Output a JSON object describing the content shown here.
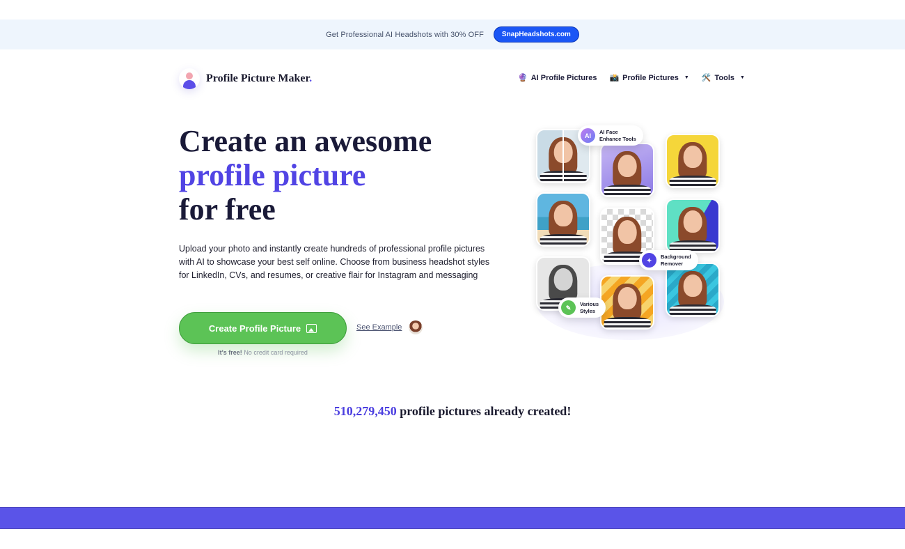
{
  "promo": {
    "text": "Get Professional AI Headshots with 30% OFF",
    "button_label": "SnapHeadshots.com"
  },
  "logo": {
    "text": "Profile Picture Maker",
    "dot": "."
  },
  "nav": {
    "items": [
      {
        "icon": "🔮",
        "label": "AI Profile Pictures"
      },
      {
        "icon": "📸",
        "label": "Profile Pictures"
      },
      {
        "icon": "🛠️",
        "label": "Tools"
      }
    ]
  },
  "hero": {
    "title_line1": "Create an awesome",
    "title_line2": "profile picture",
    "title_line3": "for free",
    "description": "Upload your photo and instantly create hundreds of professional profile pictures with AI to showcase your best self online. Choose from business headshot styles for LinkedIn, CVs, and resumes, or creative flair for Instagram and messaging",
    "cta_label": "Create Profile Picture",
    "see_example": "See Example",
    "free_bold": "It's free!",
    "free_rest": "No credit card required"
  },
  "collage": {
    "chips": {
      "ai": {
        "icon_text": "AI",
        "line1": "AI Face",
        "line2": "Enhance Tools"
      },
      "bg": {
        "line1": "Background",
        "line2": "Remover"
      },
      "styles": {
        "line1": "Various",
        "line2": "Styles"
      }
    }
  },
  "counter": {
    "number": "510,279,450",
    "text": "profile pictures already created!"
  },
  "colors": {
    "accent": "#5144e4",
    "cta": "#5cc356",
    "promo_button": "#1a56f5",
    "band": "#5a54e8"
  }
}
